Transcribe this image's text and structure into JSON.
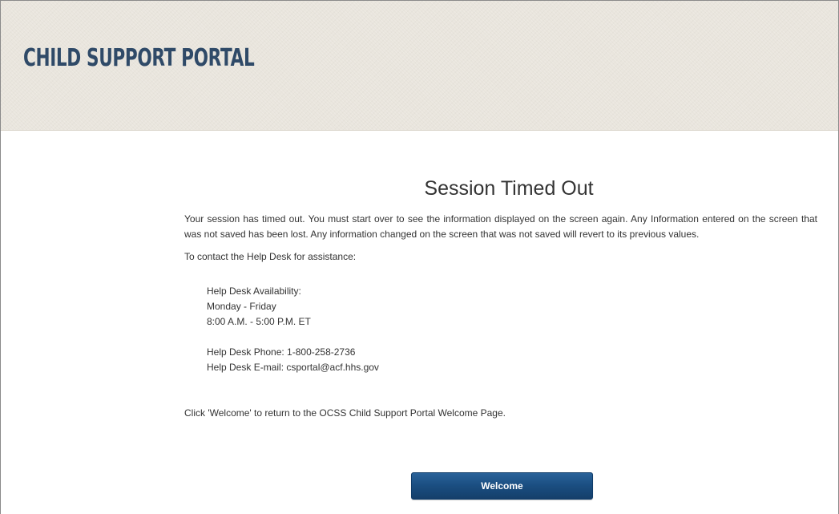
{
  "header": {
    "brand": "CHILD SUPPORT PORTAL"
  },
  "main": {
    "title": "Session Timed Out",
    "message": "Your session has timed out. You must start over to see the information displayed on the screen again. Any Information entered on the screen that was not saved has been lost. Any information changed on the screen that was not saved will revert to its previous values.",
    "contact_intro": "To contact the Help Desk for assistance:",
    "availability": {
      "label": "Help Desk Availability:",
      "days": "Monday - Friday",
      "hours": "8:00 A.M. - 5:00 P.M. ET"
    },
    "contact": {
      "phone": "Help Desk Phone: 1-800-258-2736",
      "email": "Help Desk E-mail: csportal@acf.hhs.gov"
    },
    "return_note": "Click 'Welcome' to return to the OCSS Child Support Portal Welcome Page.",
    "welcome_button": "Welcome"
  },
  "colors": {
    "brand_text": "#2f4a68",
    "header_bg": "#e9e5dd",
    "button_bg": "#1a4d80",
    "body_text": "#333333"
  }
}
